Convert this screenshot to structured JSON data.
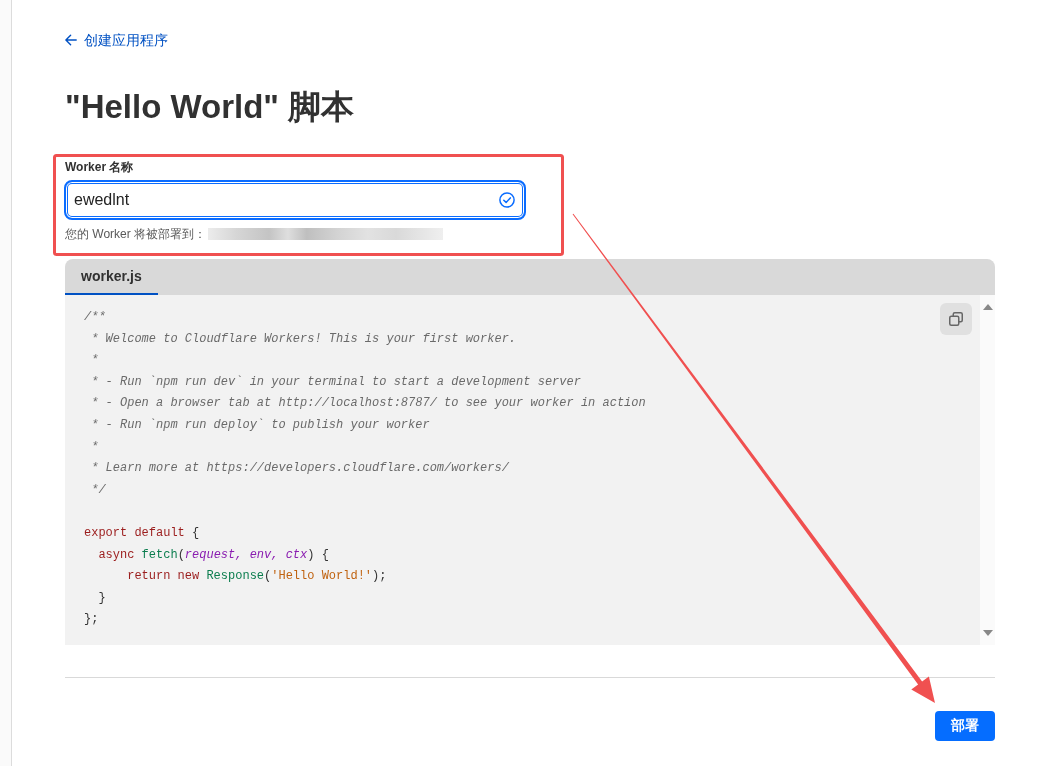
{
  "back_link": {
    "label": "创建应用程序"
  },
  "title": "\"Hello World\" 脚本",
  "name_field": {
    "label": "Worker 名称",
    "value": "ewedlnt",
    "focused": true,
    "valid": true,
    "hint": "您的 Worker 将被部署到：",
    "hint_redacted": true
  },
  "editor": {
    "tabs": [
      {
        "label": "worker.js",
        "selected": true
      }
    ],
    "lines": [
      {
        "kind": "code",
        "tokens": [
          {
            "text": "/**",
            "kind": "comment"
          }
        ]
      },
      {
        "kind": "code",
        "tokens": [
          {
            "text": " * Welcome to Cloudflare Workers! This is your first worker.",
            "kind": "comment"
          }
        ]
      },
      {
        "kind": "code",
        "tokens": [
          {
            "text": " *",
            "kind": "comment"
          }
        ]
      },
      {
        "kind": "code",
        "tokens": [
          {
            "text": " * - Run `npm run dev` in your terminal to start a development server",
            "kind": "comment"
          }
        ]
      },
      {
        "kind": "code",
        "tokens": [
          {
            "text": " * - Open a browser tab at http://localhost:8787/ to see your worker in action",
            "kind": "comment"
          }
        ]
      },
      {
        "kind": "code",
        "tokens": [
          {
            "text": " * - Run `npm run deploy` to publish your worker",
            "kind": "comment"
          }
        ]
      },
      {
        "kind": "code",
        "tokens": [
          {
            "text": " *",
            "kind": "comment"
          }
        ]
      },
      {
        "kind": "code",
        "tokens": [
          {
            "text": " * Learn more at https://developers.cloudflare.com/workers/",
            "kind": "comment"
          }
        ]
      },
      {
        "kind": "code",
        "tokens": [
          {
            "text": " */",
            "kind": "comment"
          }
        ]
      },
      {
        "kind": "blank"
      },
      {
        "kind": "code",
        "tokens": [
          {
            "text": "export default",
            "kind": "keyword"
          },
          {
            "text": " {",
            "kind": "plain"
          }
        ]
      },
      {
        "kind": "code",
        "tokens": [
          {
            "text": "  async ",
            "kind": "keyword"
          },
          {
            "text": "fetch",
            "kind": "function"
          },
          {
            "text": "(",
            "kind": "plain"
          },
          {
            "text": "request, ",
            "kind": "param"
          },
          {
            "text": "env, ",
            "kind": "param"
          },
          {
            "text": "ctx",
            "kind": "param"
          },
          {
            "text": ") {",
            "kind": "plain"
          }
        ]
      },
      {
        "kind": "code",
        "tokens": [
          {
            "text": "      return new ",
            "kind": "keyword"
          },
          {
            "text": "Response",
            "kind": "function"
          },
          {
            "text": "(",
            "kind": "plain"
          },
          {
            "text": "'Hello World!'",
            "kind": "string"
          },
          {
            "text": ");",
            "kind": "plain"
          }
        ]
      },
      {
        "kind": "code",
        "tokens": [
          {
            "text": "  }",
            "kind": "plain"
          }
        ]
      },
      {
        "kind": "code",
        "tokens": [
          {
            "text": "};",
            "kind": "plain"
          }
        ]
      }
    ]
  },
  "deploy_button": {
    "label": "部署"
  },
  "annotations": {
    "highlight_box": true,
    "arrow": true
  }
}
